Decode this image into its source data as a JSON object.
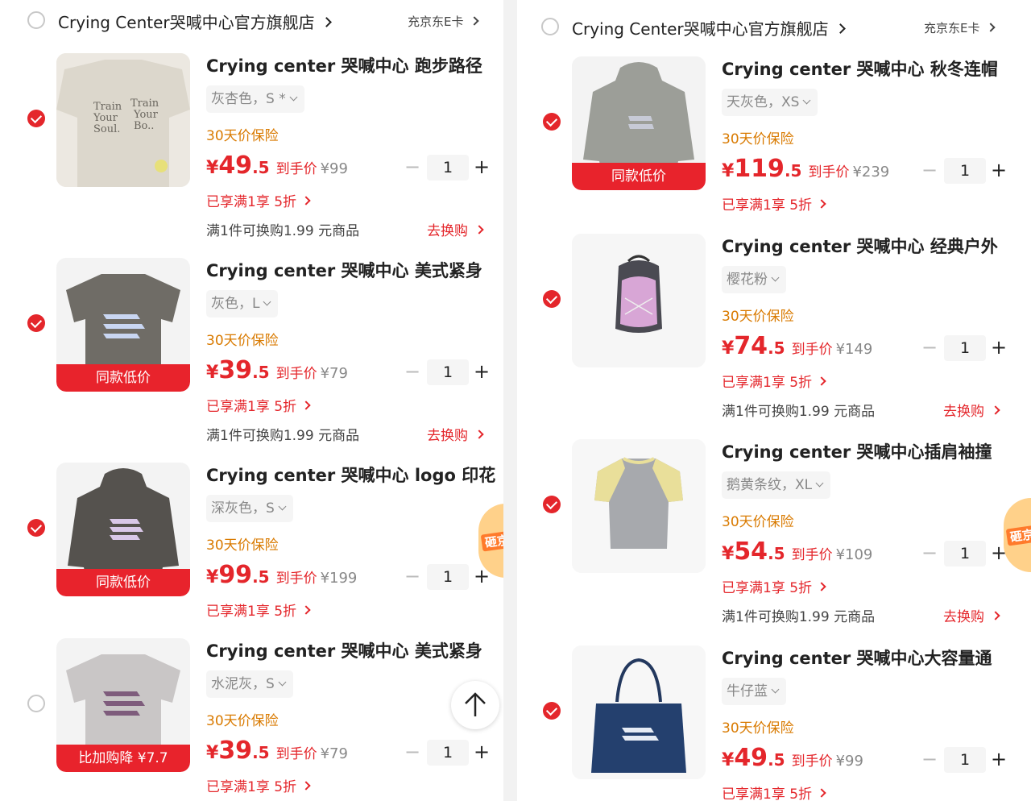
{
  "colors": {
    "accent": "#e4262b",
    "insurance": "#d97a00",
    "muted": "#888888",
    "badge": "#e8232c"
  },
  "left": {
    "shop": {
      "name": "Crying Center哭喊中心官方旗舰店",
      "tag": "充京东E卡",
      "checked": false
    },
    "items": [
      {
        "title": "Crying center 哭喊中心 跑步路径",
        "variant": "灰杏色，S *",
        "insurance": "30天价保险",
        "price_cur": "¥",
        "price_int": "49",
        "price_dec": ".5",
        "price_label": "到手价",
        "orig_price": "¥99",
        "qty": "1",
        "promo": "已享满1享 5折",
        "swap_text": "满1件可换购1.99 元商品",
        "swap_link": "去换购",
        "checked": true,
        "badge": "",
        "image": "tshirt-train-your-soul"
      },
      {
        "title": "Crying center 哭喊中心 美式紧身",
        "variant": "灰色，L",
        "insurance": "30天价保险",
        "price_cur": "¥",
        "price_int": "39",
        "price_dec": ".5",
        "price_label": "到手价",
        "orig_price": "¥79",
        "qty": "1",
        "promo": "已享满1享 5折",
        "swap_text": "满1件可换购1.99 元商品",
        "swap_link": "去换购",
        "checked": true,
        "badge": "同款低价",
        "image": "tshirt-grey-logo"
      },
      {
        "title": "Crying center 哭喊中心 logo 印花",
        "variant": "深灰色，S",
        "insurance": "30天价保险",
        "price_cur": "¥",
        "price_int": "99",
        "price_dec": ".5",
        "price_label": "到手价",
        "orig_price": "¥199",
        "qty": "1",
        "promo": "已享满1享 5折",
        "checked": true,
        "badge": "同款低价",
        "image": "hoodie-dark-grey"
      },
      {
        "title": "Crying center 哭喊中心 美式紧身",
        "variant": "水泥灰，S",
        "insurance": "30天价保险",
        "price_cur": "¥",
        "price_int": "39",
        "price_dec": ".5",
        "price_label": "到手价",
        "orig_price": "¥79",
        "qty": "1",
        "promo": "已享满1享 5折",
        "checked": false,
        "badge": "比加购降 ¥7.7",
        "image": "tshirt-cement-grey"
      }
    ],
    "side_tab": "砸京"
  },
  "right": {
    "shop": {
      "name": "Crying Center哭喊中心官方旗舰店",
      "tag": "充京东E卡",
      "checked": false
    },
    "items": [
      {
        "title": "Crying center 哭喊中心 秋冬连帽",
        "variant": "天灰色，XS",
        "insurance": "30天价保险",
        "price_cur": "¥",
        "price_int": "119",
        "price_dec": ".5",
        "price_label": "到手价",
        "orig_price": "¥239",
        "qty": "1",
        "promo": "已享满1享 5折",
        "checked": true,
        "badge": "同款低价",
        "image": "hoodie-sky-grey"
      },
      {
        "title": "Crying center 哭喊中心 经典户外",
        "variant": "樱花粉",
        "insurance": "30天价保险",
        "price_cur": "¥",
        "price_int": "74",
        "price_dec": ".5",
        "price_label": "到手价",
        "orig_price": "¥149",
        "qty": "1",
        "promo": "已享满1享 5折",
        "swap_text": "满1件可换购1.99 元商品",
        "swap_link": "去换购",
        "checked": true,
        "badge": "",
        "image": "backpack-pink"
      },
      {
        "title": "Crying center 哭喊中心插肩袖撞",
        "variant": "鹅黄条纹，XL",
        "insurance": "30天价保险",
        "price_cur": "¥",
        "price_int": "54",
        "price_dec": ".5",
        "price_label": "到手价",
        "orig_price": "¥109",
        "qty": "1",
        "promo": "已享满1享 5折",
        "swap_text": "满1件可换购1.99 元商品",
        "swap_link": "去换购",
        "checked": true,
        "badge": "",
        "image": "raglan-tee-yellow-stripe"
      },
      {
        "title": "Crying center 哭喊中心大容量通",
        "variant": "牛仔蓝",
        "insurance": "30天价保险",
        "price_cur": "¥",
        "price_int": "49",
        "price_dec": ".5",
        "price_label": "到手价",
        "orig_price": "¥99",
        "qty": "1",
        "promo": "已享满1享 5折",
        "checked": true,
        "badge": "",
        "image": "tote-denim-blue"
      }
    ],
    "side_tab": "砸京"
  },
  "stepper": {
    "minus": "−",
    "plus": "+"
  },
  "scroll_top_icon": "arrow-up-icon"
}
